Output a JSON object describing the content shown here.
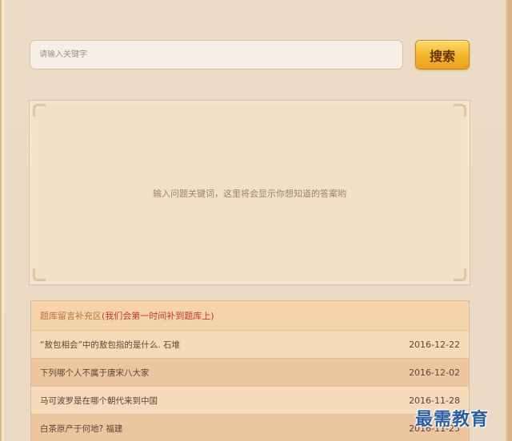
{
  "search": {
    "placeholder": "请输入关键字",
    "button_label": "搜索"
  },
  "results": {
    "hint": "输入问题关键词，这里将会显示你想知道的答案哟"
  },
  "board": {
    "title": "题库留言补充区",
    "note": "(我们会第一时间补到题库上)",
    "items": [
      {
        "question": "“敖包相会”中的敖包指的是什么. 石堆",
        "date": "2016-12-22"
      },
      {
        "question": "下列哪个人不属于唐宋八大家",
        "date": "2016-12-02"
      },
      {
        "question": "马可波罗是在哪个朝代来到中国",
        "date": "2016-11-28"
      },
      {
        "question": "白茶原产于何地? 福建",
        "date": "2016-11-25"
      }
    ]
  },
  "watermark": "最需教育",
  "colors": {
    "accent": "#f4b52d",
    "note_red": "#c23a2a",
    "title_orange": "#c0713e"
  }
}
